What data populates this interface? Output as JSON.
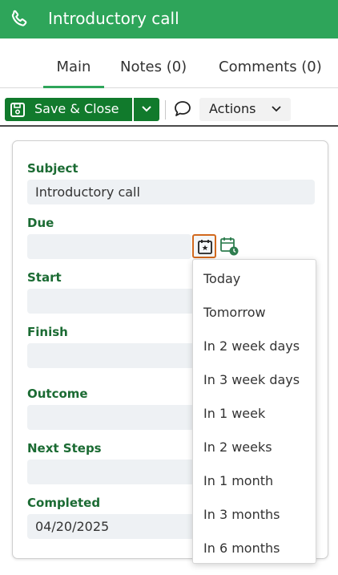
{
  "header": {
    "title": "Introductory call",
    "icon": "phone-icon",
    "color": "#2ea55a"
  },
  "tabs": [
    {
      "label": "Main",
      "active": true
    },
    {
      "label": "Notes (0)",
      "active": false
    },
    {
      "label": "Comments (0)",
      "active": false
    }
  ],
  "toolbar": {
    "save_label": "Save & Close",
    "actions_label": "Actions",
    "save_color": "#117a2c"
  },
  "form": {
    "subject": {
      "label": "Subject",
      "value": "Introductory call"
    },
    "due": {
      "label": "Due",
      "value": ""
    },
    "start": {
      "label": "Start",
      "value": ""
    },
    "finish": {
      "label": "Finish",
      "value": ""
    },
    "outcome": {
      "label": "Outcome",
      "value": ""
    },
    "next_steps": {
      "label": "Next Steps",
      "value": ""
    },
    "completed": {
      "label": "Completed",
      "value": "04/20/2025"
    }
  },
  "date_menu": {
    "items": [
      "Today",
      "Tomorrow",
      "In 2 week days",
      "In 3 week days",
      "In 1 week",
      "In 2 weeks",
      "In 1 month",
      "In 3 months",
      "In 6 months"
    ]
  }
}
